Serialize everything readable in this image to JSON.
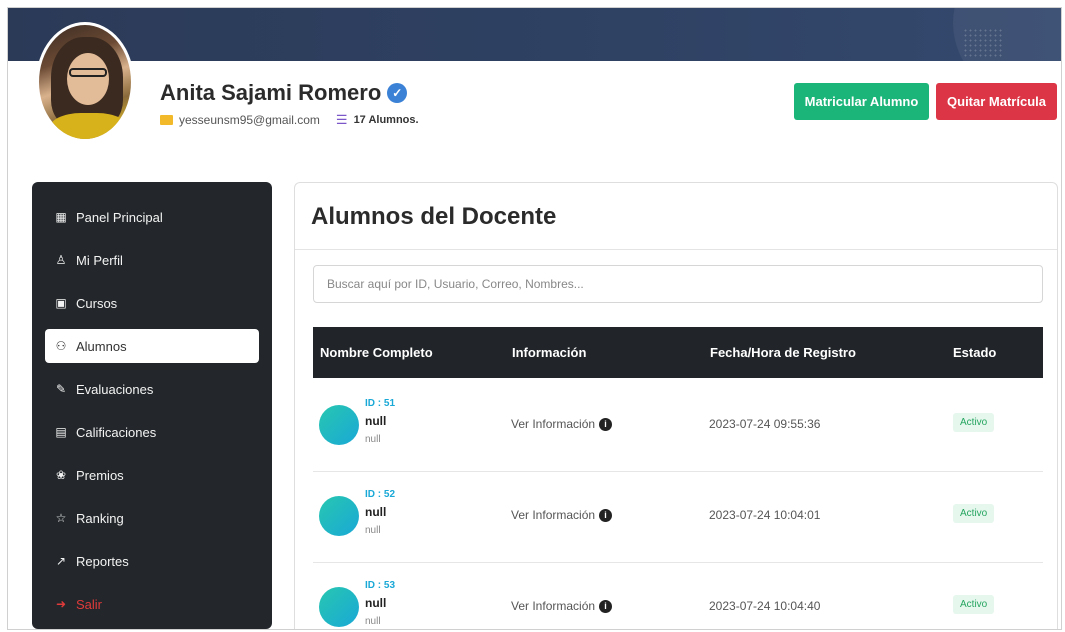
{
  "profile": {
    "name": "Anita Sajami Romero",
    "email": "yesseunsm95@gmail.com",
    "student_count": "17 Alumnos."
  },
  "actions": {
    "enroll_label": "Matricular Alumno",
    "unenroll_label": "Quitar Matrícula"
  },
  "sidebar": {
    "items": [
      {
        "label": "Panel Principal",
        "icon": "grid-icon"
      },
      {
        "label": "Mi Perfil",
        "icon": "user-icon"
      },
      {
        "label": "Cursos",
        "icon": "book-icon"
      },
      {
        "label": "Alumnos",
        "icon": "users-icon",
        "active": true
      },
      {
        "label": "Evaluaciones",
        "icon": "edit-icon"
      },
      {
        "label": "Calificaciones",
        "icon": "card-icon"
      },
      {
        "label": "Premios",
        "icon": "award-icon"
      },
      {
        "label": "Ranking",
        "icon": "star-icon"
      },
      {
        "label": "Reportes",
        "icon": "chart-icon"
      },
      {
        "label": "Salir",
        "icon": "logout-icon"
      }
    ]
  },
  "main": {
    "title": "Alumnos del Docente",
    "search_placeholder": "Buscar aquí por ID, Usuario, Correo, Nombres...",
    "columns": [
      "Nombre Completo",
      "Información",
      "Fecha/Hora de Registro",
      "Estado"
    ],
    "rows": [
      {
        "id": "ID : 51",
        "name": "null",
        "sub": "null",
        "info": "Ver Información",
        "date": "2023-07-24 09:55:36",
        "status": "Activo"
      },
      {
        "id": "ID : 52",
        "name": "null",
        "sub": "null",
        "info": "Ver Información",
        "date": "2023-07-24 10:04:01",
        "status": "Activo"
      },
      {
        "id": "ID : 53",
        "name": "null",
        "sub": "null",
        "info": "Ver Información",
        "date": "2023-07-24 10:04:40",
        "status": "Activo"
      }
    ]
  },
  "colors": {
    "banner": "#2f4264",
    "enroll": "#1bb57a",
    "unenroll": "#dc3545",
    "sidebar": "#23272b",
    "accent": "#1aa8d6"
  }
}
